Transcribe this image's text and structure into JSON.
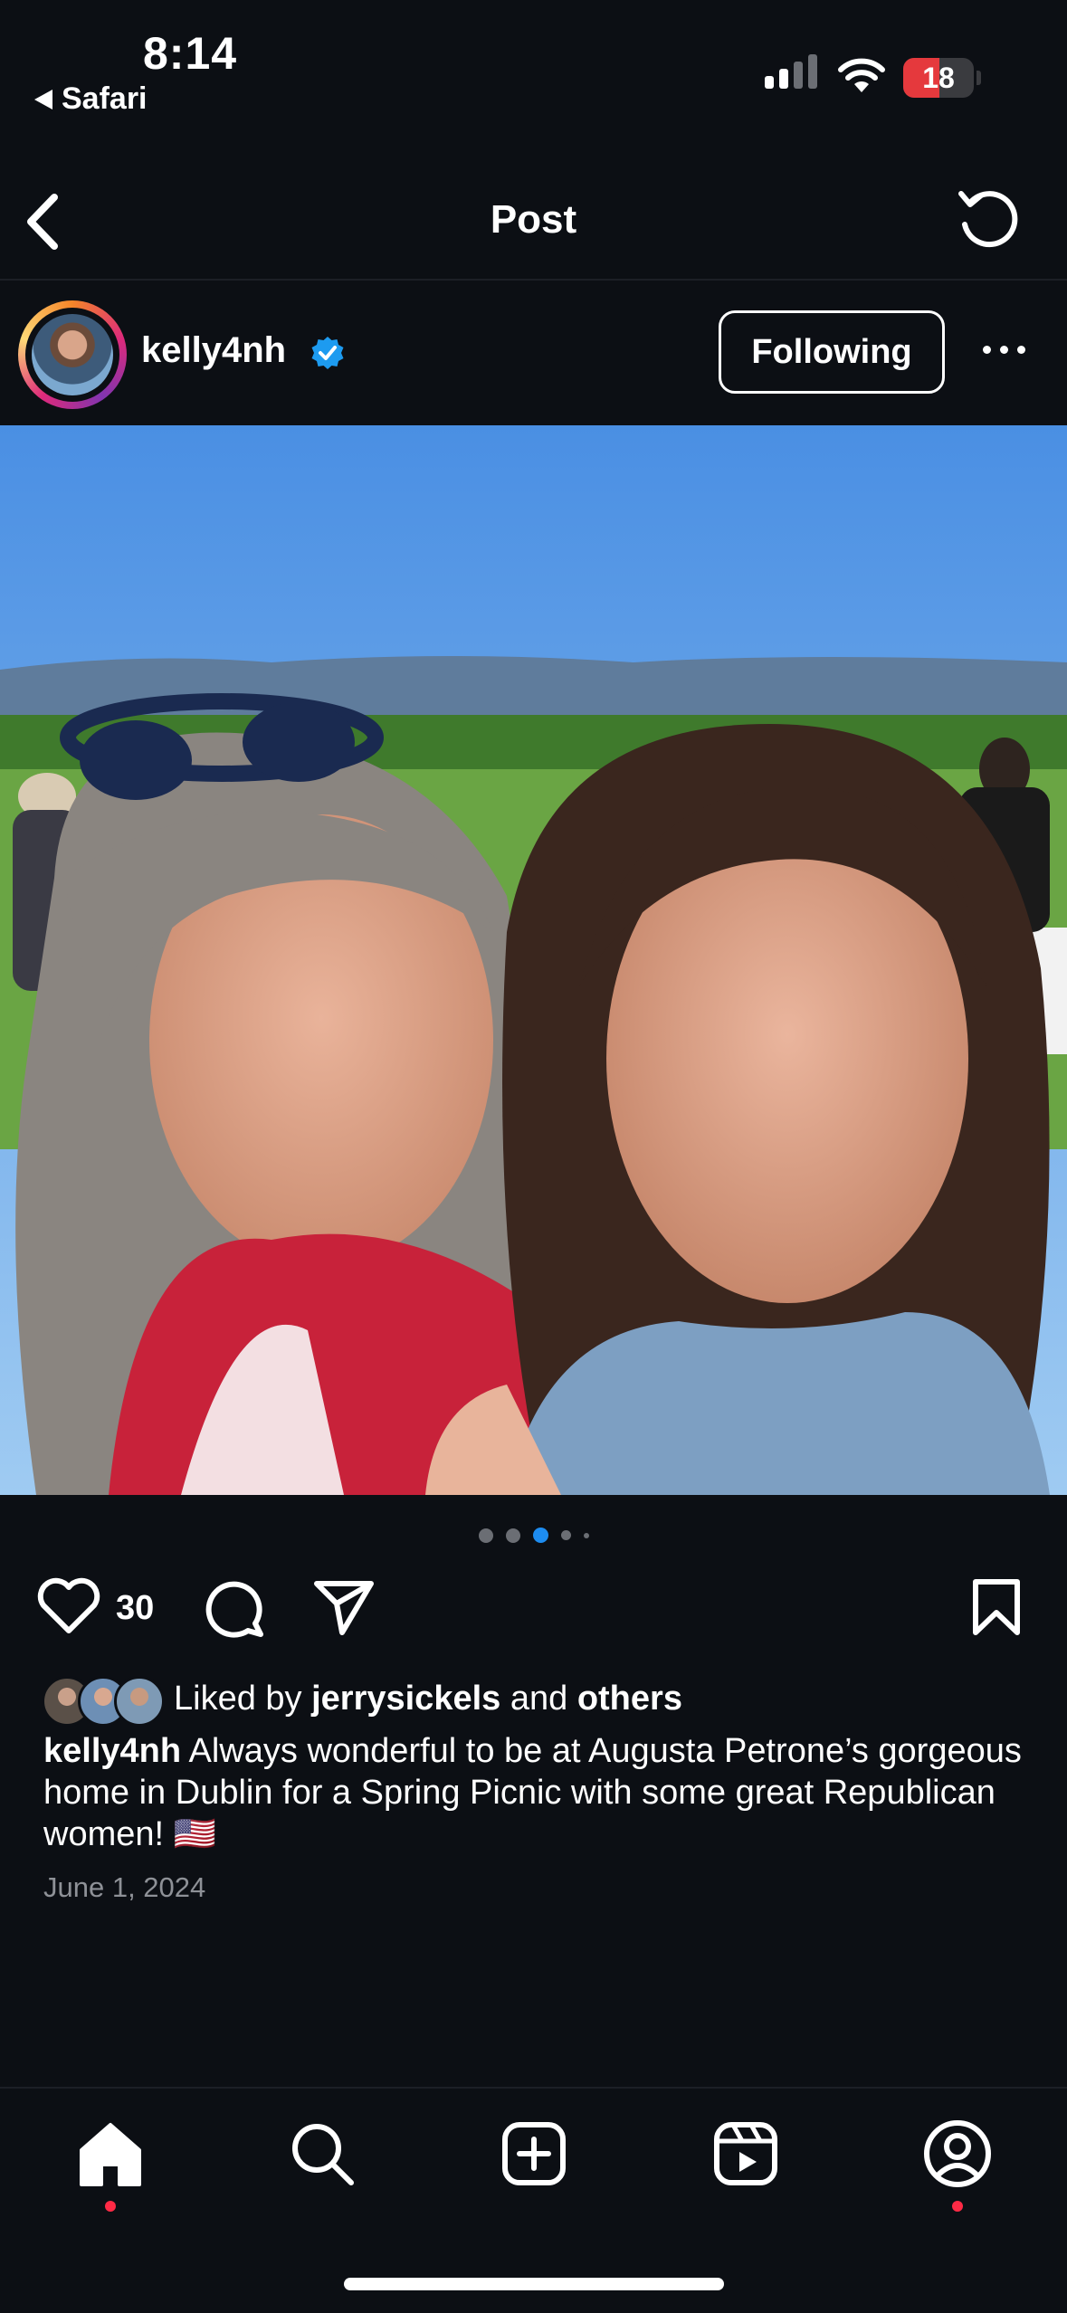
{
  "status_bar": {
    "time": "8:14",
    "back_app": "Safari",
    "battery": "18"
  },
  "nav": {
    "title": "Post"
  },
  "post": {
    "username": "kelly4nh",
    "follow_label": "Following",
    "like_count": "30",
    "liked_by_prefix": "Liked by ",
    "liked_by_user": "jerrysickels",
    "liked_by_mid": " and ",
    "liked_by_others": "others",
    "caption_user": "kelly4nh",
    "caption_text": " Always wonderful to be at Augusta Petrone’s gorgeous home in Dublin for a Spring Picnic with some great Republican women! 🇺🇸",
    "date": "June 1, 2024",
    "carousel_active_index": 2,
    "carousel_count": 5
  },
  "tabs": [
    {
      "name": "home",
      "icon": "home-icon",
      "active": true,
      "badge": true
    },
    {
      "name": "search",
      "icon": "search-icon",
      "active": false,
      "badge": false
    },
    {
      "name": "create",
      "icon": "plus-square-icon",
      "active": false,
      "badge": false
    },
    {
      "name": "reels",
      "icon": "reels-icon",
      "active": false,
      "badge": false
    },
    {
      "name": "profile",
      "icon": "profile-icon",
      "active": false,
      "badge": true
    }
  ],
  "colors": {
    "background": "#0c0f14",
    "verified": "#1d9bf0",
    "badge": "#ff2a45",
    "battery_low": "#e5393d",
    "carousel_active": "#1d8cf0"
  }
}
